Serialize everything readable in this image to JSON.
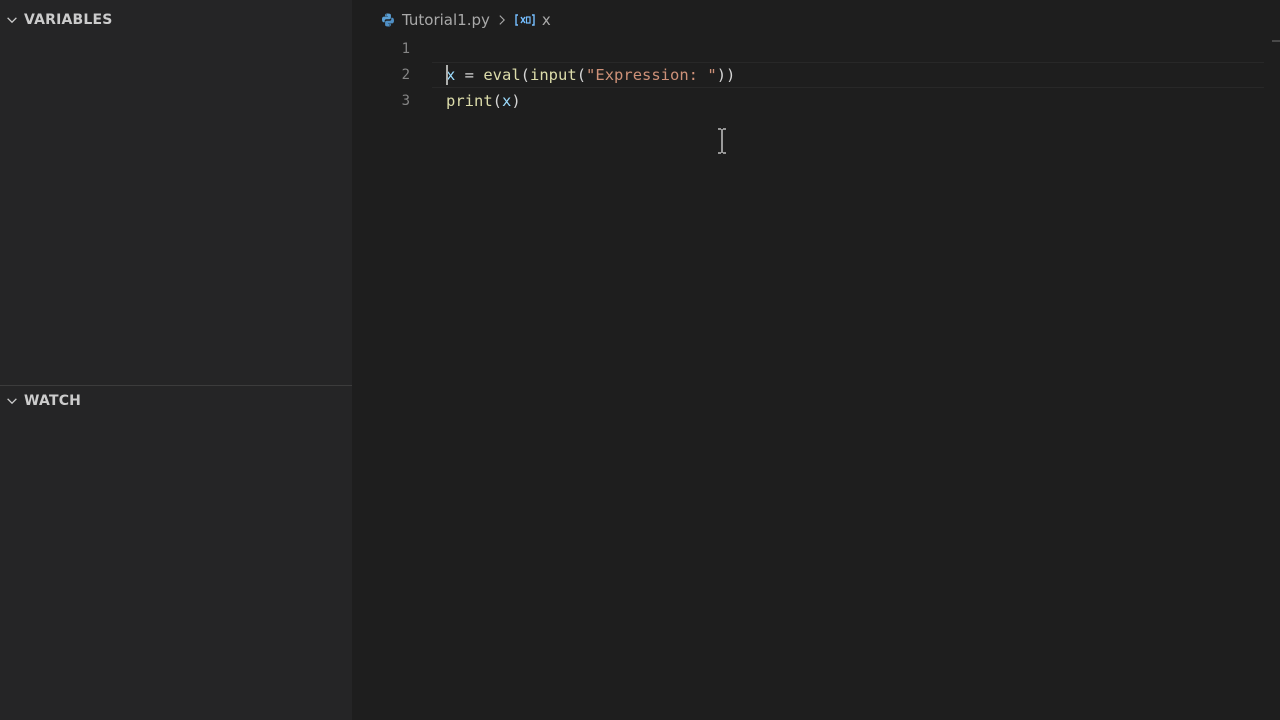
{
  "sidebar": {
    "variables_label": "VARIABLES",
    "watch_label": "WATCH"
  },
  "breadcrumb": {
    "file": "Tutorial1.py",
    "symbol": "x"
  },
  "editor": {
    "line_numbers": [
      "1",
      "2",
      "3"
    ],
    "line2": {
      "var": "x",
      "op": " = ",
      "fn_eval": "eval",
      "p1": "(",
      "fn_input": "input",
      "p2": "(",
      "str": "\"Expression: \"",
      "p3": "))"
    },
    "line3": {
      "fn_print": "print",
      "p1": "(",
      "var": "x",
      "p2": ")"
    }
  },
  "colors": {
    "background": "#1e1e1e",
    "sidebar": "#252526",
    "function": "#dcdcaa",
    "variable": "#9cdcfe",
    "string": "#ce9178"
  }
}
